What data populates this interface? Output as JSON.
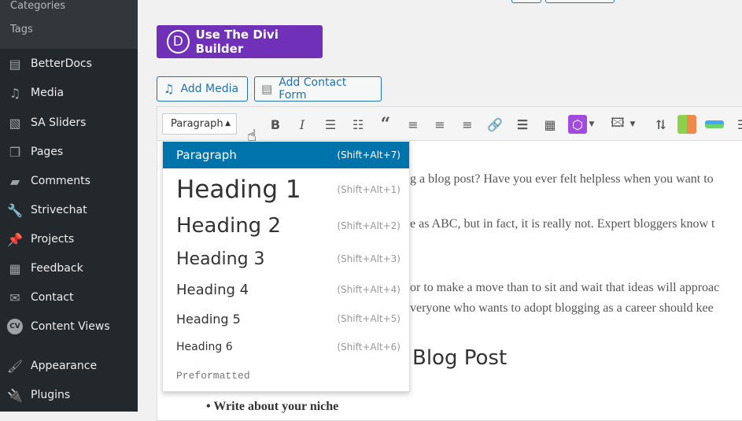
{
  "sidebar": {
    "submenu": [
      "Categories",
      "Tags"
    ],
    "items": [
      {
        "label": "BetterDocs",
        "icon": "doc-icon"
      },
      {
        "label": "Media",
        "icon": "media-icon"
      },
      {
        "label": "SA Sliders",
        "icon": "slides-icon"
      },
      {
        "label": "Pages",
        "icon": "pages-icon"
      },
      {
        "label": "Comments",
        "icon": "comment-icon"
      },
      {
        "label": "Strivechat",
        "icon": "wrench-icon"
      },
      {
        "label": "Projects",
        "icon": "pin-icon"
      },
      {
        "label": "Feedback",
        "icon": "feedback-icon"
      },
      {
        "label": "Contact",
        "icon": "mail-icon"
      },
      {
        "label": "Content Views",
        "icon": "cv-icon"
      },
      {
        "label": "Appearance",
        "icon": "brush-icon"
      },
      {
        "label": "Plugins",
        "icon": "plug-icon"
      }
    ]
  },
  "divi": {
    "label": "Use The Divi Builder",
    "logo": "D"
  },
  "buttons": {
    "add_media": "Add Media",
    "add_contact_form": "Add Contact Form"
  },
  "toolbar": {
    "format_value": "Paragraph"
  },
  "format_menu": [
    {
      "label": "Paragraph",
      "shortcut": "(Shift+Alt+7)",
      "selected": true
    },
    {
      "label": "Heading 1",
      "shortcut": "(Shift+Alt+1)"
    },
    {
      "label": "Heading 2",
      "shortcut": "(Shift+Alt+2)"
    },
    {
      "label": "Heading 3",
      "shortcut": "(Shift+Alt+3)"
    },
    {
      "label": "Heading 4",
      "shortcut": "(Shift+Alt+4)"
    },
    {
      "label": "Heading 5",
      "shortcut": "(Shift+Alt+5)"
    },
    {
      "label": "Heading 6",
      "shortcut": "(Shift+Alt+6)"
    },
    {
      "label": "Preformatted",
      "shortcut": ""
    }
  ],
  "content": {
    "lines": [
      "g a blog post? Have you ever felt helpless when you want to",
      "e as ABC, but in fact, it is really not. Expert bloggers know t",
      "or to make a move than to sit and wait that ideas will approac",
      "veryone who wants to adopt blogging as a career should kee"
    ],
    "heading": "Blog Post",
    "bullet": "Write about your niche"
  },
  "colors": {
    "divi": "#7030b8",
    "accent": "#0073aa",
    "sidebar": "#23282d"
  }
}
